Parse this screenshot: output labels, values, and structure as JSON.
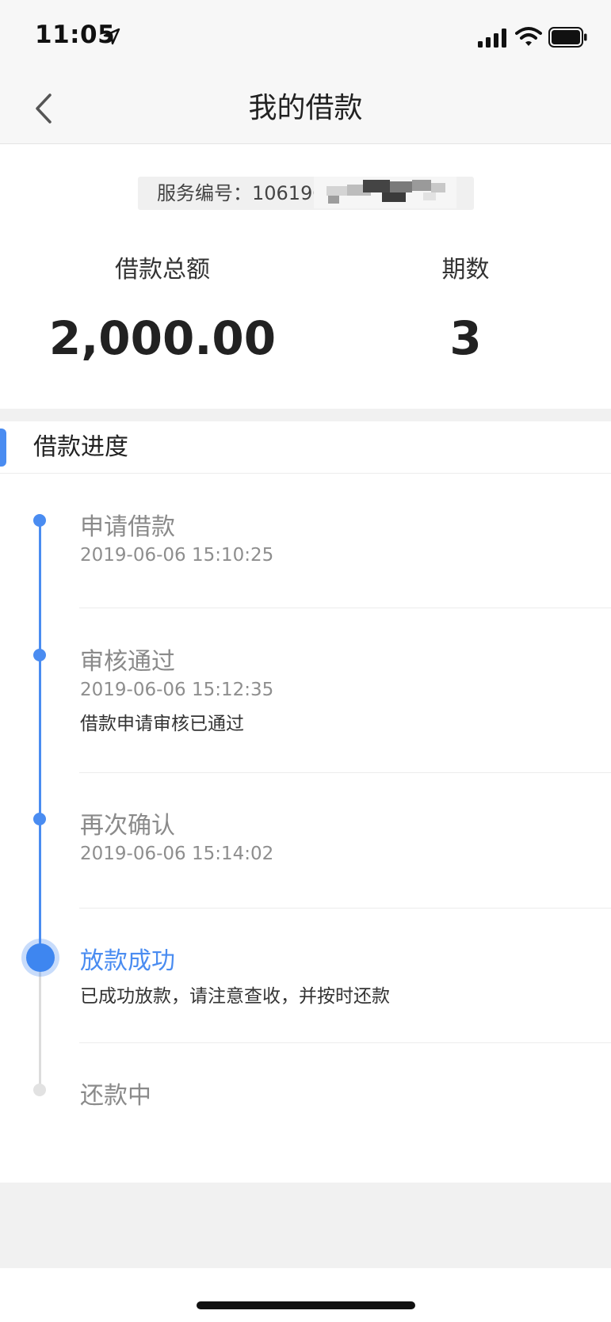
{
  "status_bar": {
    "time": "11:05",
    "icons": [
      "location-arrow-icon",
      "signal-icon",
      "wifi-icon",
      "battery-icon"
    ]
  },
  "nav": {
    "title": "我的借款",
    "back_icon": "chevron-left-icon"
  },
  "summary": {
    "service_no": "服务编号：10619C",
    "total_label": "借款总额",
    "total_value": "2,000.00",
    "periods_label": "期数",
    "periods_value": "3"
  },
  "progress": {
    "title": "借款进度",
    "steps": [
      {
        "title": "申请借款",
        "time": "2019-06-06 15:10:25",
        "note": "",
        "state": "done"
      },
      {
        "title": "审核通过",
        "time": "2019-06-06 15:12:35",
        "note": "借款申请审核已通过",
        "state": "done"
      },
      {
        "title": "再次确认",
        "time": "2019-06-06 15:14:02",
        "note": "",
        "state": "done"
      },
      {
        "title": "放款成功",
        "time": "",
        "note": "已成功放款，请注意查收，并按时还款",
        "state": "current"
      },
      {
        "title": "还款中",
        "time": "",
        "note": "",
        "state": "pending"
      }
    ]
  },
  "colors": {
    "accent": "#4a8cf1",
    "pending": "#e2e2e2",
    "muted_text": "#8a8a8a",
    "page_gray": "#f1f1f1"
  }
}
